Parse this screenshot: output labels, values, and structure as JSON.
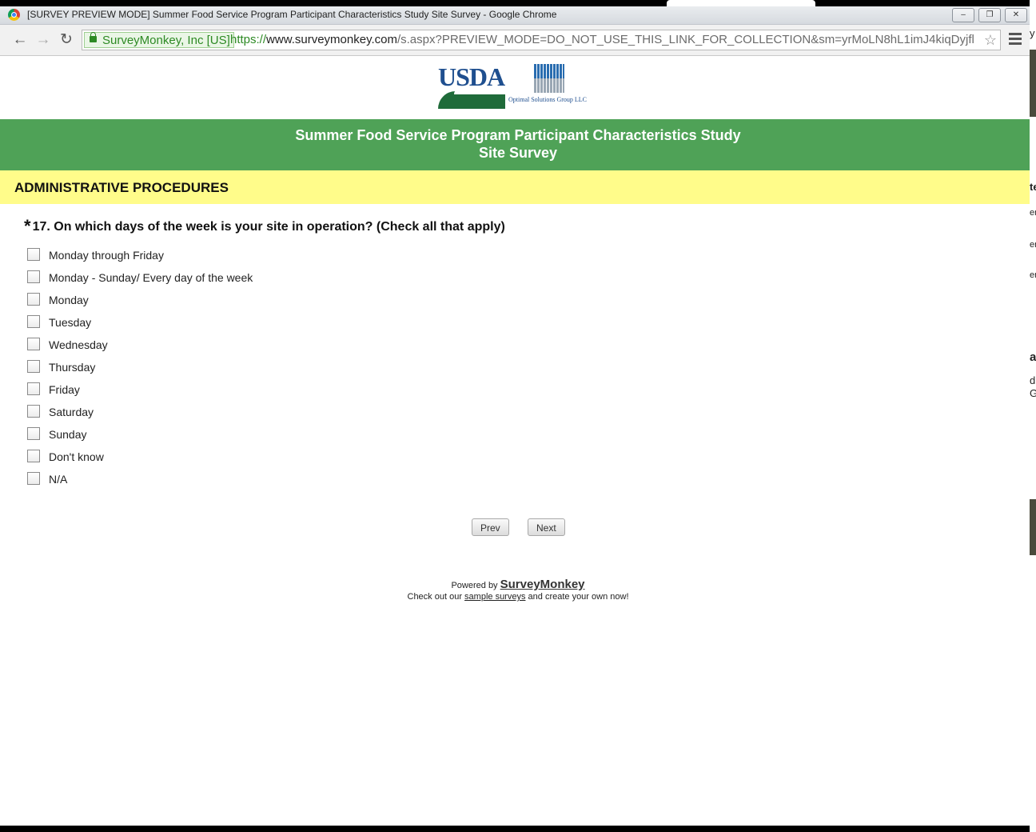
{
  "browser": {
    "title": "[SURVEY PREVIEW MODE] Summer Food Service Program Participant Characteristics Study Site Survey - Google Chrome",
    "ev_label": "SurveyMonkey, Inc [US]",
    "url_scheme": "https://",
    "url_host": "www.surveymonkey.com",
    "url_path": "/s.aspx?PREVIEW_MODE=DO_NOT_USE_THIS_LINK_FOR_COLLECTION&sm=yrMoLN8hL1imJ4kiqDyjfl"
  },
  "logos": {
    "usda": "USDA",
    "osg": "Optimal Solutions Group LLC"
  },
  "banner": {
    "line1": "Summer Food Service Program Participant Characteristics Study",
    "line2": "Site Survey"
  },
  "section": {
    "title": "ADMINISTRATIVE PROCEDURES"
  },
  "question": {
    "required_mark": "*",
    "text": "17. On which days of the week is your site in operation? (Check all that apply)",
    "options": [
      "Monday through Friday",
      "Monday - Sunday/ Every day of the week",
      "Monday",
      "Tuesday",
      "Wednesday",
      "Thursday",
      "Friday",
      "Saturday",
      "Sunday",
      "Don't know",
      "N/A"
    ]
  },
  "nav": {
    "prev": "Prev",
    "next": "Next"
  },
  "footer": {
    "powered_by": "Powered by",
    "brand": "SurveyMonkey",
    "checkout_prefix": "Check out our",
    "sample_link": "sample surveys",
    "checkout_suffix": "and create your own now!"
  },
  "colors": {
    "banner": "#4fa257",
    "section": "#fffc8a"
  }
}
